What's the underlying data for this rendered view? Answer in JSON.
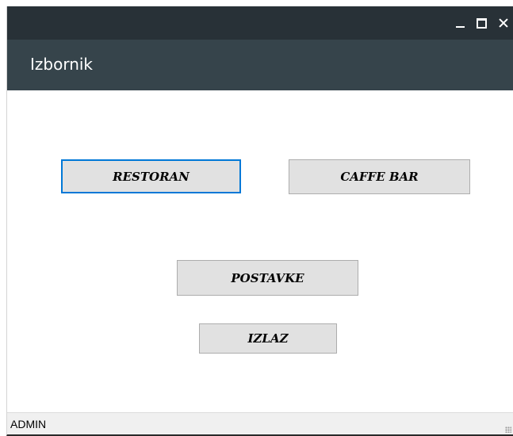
{
  "window": {
    "title": "Izbornik"
  },
  "title_bar": {
    "minimize_icon": "minimize-icon",
    "maximize_icon": "maximize-icon",
    "close_icon": "close-icon"
  },
  "menu": {
    "restoran_label": "RESTORAN",
    "caffe_bar_label": "CAFFE BAR",
    "postavke_label": "POSTAVKE",
    "izlaz_label": "IZLAZ"
  },
  "status_bar": {
    "user": "ADMIN"
  },
  "colors": {
    "title_bar": "#283137",
    "header": "#36444b",
    "button_face": "#e1e1e1",
    "focus_border": "#0078d7",
    "status_bar": "#f0f0f0"
  }
}
